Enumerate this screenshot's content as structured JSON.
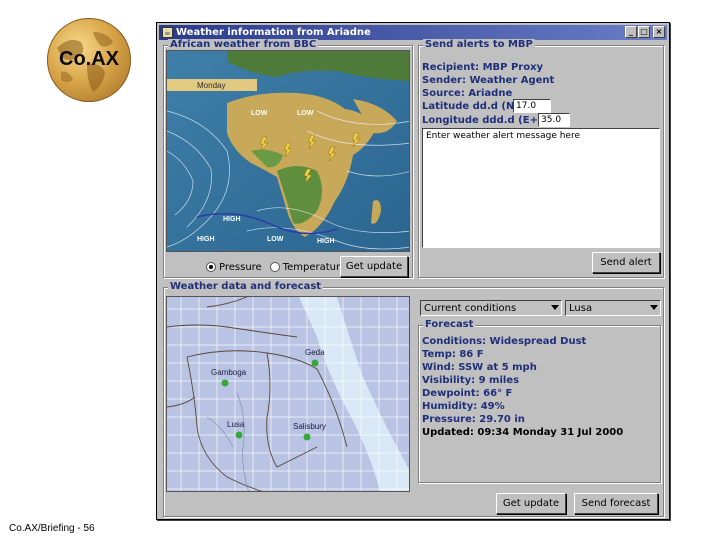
{
  "slide": {
    "logo_text": "Co.AX",
    "footer": "Co.AX/Briefing - 56"
  },
  "window": {
    "title": "Weather information from Ariadne",
    "controls": [
      "_",
      "□",
      "×"
    ]
  },
  "bbc_panel": {
    "title": "African weather from BBC",
    "map_labels": {
      "day": "Monday",
      "lows": [
        "LOW",
        "LOW"
      ],
      "highs": [
        "HIGH",
        "HIGH",
        "LOW",
        "HIGH"
      ]
    },
    "radio": {
      "pressure_label": "Pressure",
      "temperature_label": "Temperature",
      "selected": "Pressure"
    },
    "update_button": "Get update"
  },
  "alert_panel": {
    "title": "Send alerts to MBP",
    "recipient": "Recipient: MBP Proxy",
    "sender": "Sender: Weather Agent",
    "source": "Source: Ariadne",
    "latitude_label": "Latitude dd.d (N+ S-)",
    "latitude_value": "17.0",
    "longitude_label": "Longitude ddd.d (E+ W-)",
    "longitude_value": "35.0",
    "message": "Enter weather alert message here",
    "send_button": "Send alert"
  },
  "forecast_panel": {
    "title": "Weather data and forecast",
    "mode_select": "Current conditions",
    "location_select": "Lusa",
    "map_cities": [
      "Geda",
      "Gamboga",
      "Lusa",
      "Salisbury"
    ],
    "forecast_title": "Forecast",
    "lines": [
      "Conditions: Widespread Dust",
      "Temp: 86 F",
      "Wind: SSW at 5 mph",
      "Visibility: 9 miles",
      "Dewpoint: 66° F",
      "Humidity: 49%",
      "Pressure: 29.70 in"
    ],
    "updated": "Updated: 09:34 Monday 31 Jul 2000",
    "get_update_button": "Get update",
    "send_forecast_button": "Send forecast"
  }
}
